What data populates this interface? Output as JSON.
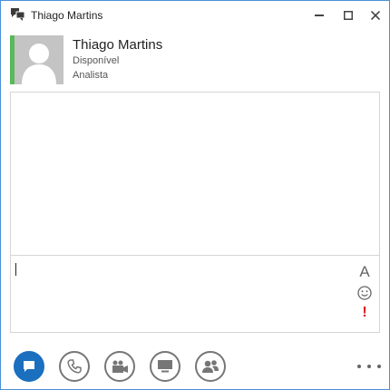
{
  "window": {
    "title": "Thiago Martins",
    "controls": [
      "minimize",
      "maximize",
      "close"
    ]
  },
  "contact": {
    "name": "Thiago Martins",
    "status": "Disponível",
    "job_title": "Analista",
    "presence_color": "#5cb85c"
  },
  "compose": {
    "tools": [
      "font-icon",
      "emoticon-icon",
      "priority-icon"
    ],
    "font_glyph": "A",
    "priority_glyph": "!"
  },
  "toolbar": {
    "buttons": [
      "im-icon",
      "phone-icon",
      "video-icon",
      "present-icon",
      "people-icon"
    ],
    "active_color": "#1a6fbf",
    "more": "more-options-icon"
  }
}
